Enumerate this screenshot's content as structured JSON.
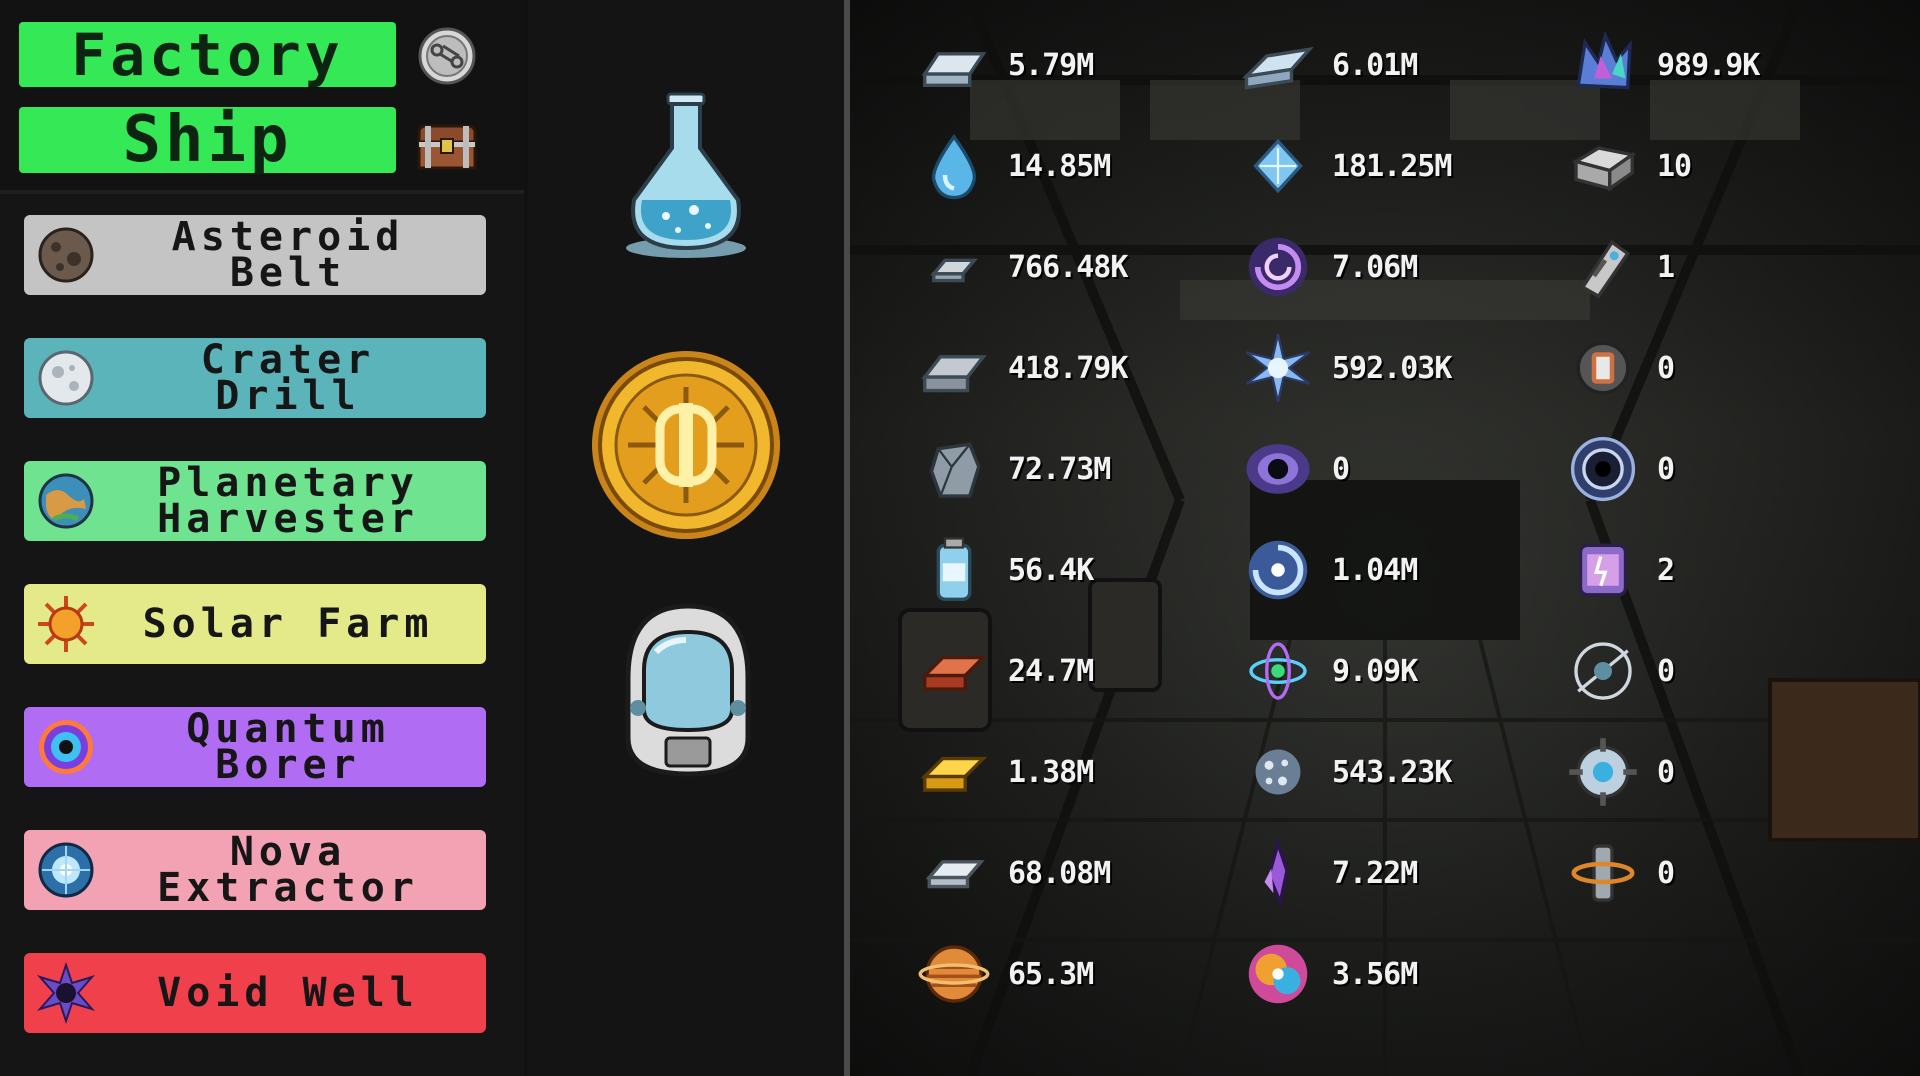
{
  "top_buttons": {
    "factory_label": "Factory",
    "ship_label": "Ship",
    "factory_icon": "gear-badge-icon",
    "ship_icon": "treasure-chest-icon"
  },
  "machines": [
    {
      "label": "Asteroid\nBelt",
      "icon": "asteroid-icon",
      "color": "#c4c4c4"
    },
    {
      "label": "Crater\nDrill",
      "icon": "moon-icon",
      "color": "#5bb4b9"
    },
    {
      "label": "Planetary\nHarvester",
      "icon": "planet-icon",
      "color": "#6fe38f"
    },
    {
      "label": "Solar Farm",
      "icon": "sun-icon",
      "color": "#e4e98a"
    },
    {
      "label": "Quantum\nBorer",
      "icon": "quantum-eye-icon",
      "color": "#b06cf3"
    },
    {
      "label": "Nova\nExtractor",
      "icon": "nova-icon",
      "color": "#f3a2b4"
    },
    {
      "label": "Void Well",
      "icon": "void-icon",
      "color": "#f0404c"
    }
  ],
  "middle_items": [
    {
      "icon": "research-flask-icon"
    },
    {
      "icon": "gold-coin-icon"
    },
    {
      "icon": "astronaut-helmet-icon"
    }
  ],
  "resources": {
    "col1": [
      {
        "icon": "iron-ingot-icon",
        "value": "5.79M"
      },
      {
        "icon": "water-drop-icon",
        "value": "14.85M"
      },
      {
        "icon": "small-ingot-icon",
        "value": "766.48K"
      },
      {
        "icon": "steel-bar-icon",
        "value": "418.79K"
      },
      {
        "icon": "metal-chunk-icon",
        "value": "72.73M"
      },
      {
        "icon": "fuel-canister-icon",
        "value": "56.4K"
      },
      {
        "icon": "copper-ingot-icon",
        "value": "24.7M"
      },
      {
        "icon": "gold-ingot-icon",
        "value": "1.38M"
      },
      {
        "icon": "silver-ingot-icon",
        "value": "68.08M"
      },
      {
        "icon": "gas-planet-icon",
        "value": "65.3M"
      }
    ],
    "col2": [
      {
        "icon": "titanium-ingot-icon",
        "value": "6.01M"
      },
      {
        "icon": "ice-crystal-icon",
        "value": "181.25M"
      },
      {
        "icon": "galaxy-swirl-icon",
        "value": "7.06M"
      },
      {
        "icon": "star-burst-icon",
        "value": "592.03K"
      },
      {
        "icon": "black-hole-icon",
        "value": "0"
      },
      {
        "icon": "vortex-icon",
        "value": "1.04M"
      },
      {
        "icon": "atom-icon",
        "value": "9.09K"
      },
      {
        "icon": "stardust-icon",
        "value": "543.23K"
      },
      {
        "icon": "crystal-shard-icon",
        "value": "7.22M"
      },
      {
        "icon": "nebula-icon",
        "value": "3.56M"
      }
    ],
    "col3": [
      {
        "icon": "crystal-cluster-icon",
        "value": "989.9K"
      },
      {
        "icon": "circuit-block-icon",
        "value": "10"
      },
      {
        "icon": "rocket-part-icon",
        "value": "1"
      },
      {
        "icon": "core-module-icon",
        "value": "0"
      },
      {
        "icon": "wormhole-icon",
        "value": "0"
      },
      {
        "icon": "power-cell-icon",
        "value": "2"
      },
      {
        "icon": "orbit-icon",
        "value": "0"
      },
      {
        "icon": "targeting-core-icon",
        "value": "0"
      },
      {
        "icon": "satellite-icon",
        "value": "0"
      }
    ]
  }
}
